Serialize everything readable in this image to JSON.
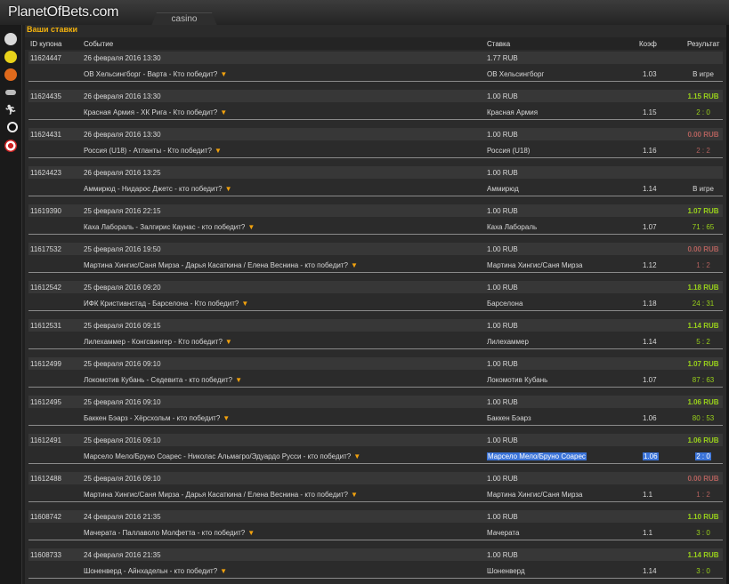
{
  "logo": "PlanetOfBets.com",
  "casino_tab": "casino",
  "panel_title": "Ваши ставки",
  "columns": {
    "id": "ID купона",
    "event": "Событие",
    "stake": "Ставка",
    "coef": "Коэф",
    "result": "Результат"
  },
  "sidebar_icons": [
    "soccer-ball-icon",
    "tennis-ball-icon",
    "basketball-icon",
    "hockey-icon",
    "athletics-icon",
    "billiards-icon",
    "darts-icon"
  ],
  "colors": {
    "accent": "#f2b20e",
    "win": "#99d11b",
    "lose": "#b0605c",
    "selection": "#3a73d8"
  },
  "bets": [
    {
      "id": "11624447",
      "date": "26 февраля 2016 13:30",
      "stake": "1.77 RUB",
      "event": "ОВ Хельсингборг - Варта - Кто победит?",
      "selection": "ОВ Хельсингборг",
      "coef": "1.03",
      "amount": "",
      "result": "В игре",
      "status": "ingame"
    },
    {
      "id": "11624435",
      "date": "26 февраля 2016 13:30",
      "stake": "1.00 RUB",
      "event": "Красная Армия - ХК Рига - Кто победит?",
      "selection": "Красная Армия",
      "coef": "1.15",
      "amount": "1.15 RUB",
      "result": "2 : 0",
      "status": "win"
    },
    {
      "id": "11624431",
      "date": "26 февраля 2016 13:30",
      "stake": "1.00 RUB",
      "event": "Россия (U18) - Атланты - Кто победит?",
      "selection": "Россия (U18)",
      "coef": "1.16",
      "amount": "0.00 RUB",
      "result": "2 : 2",
      "status": "lose"
    },
    {
      "id": "11624423",
      "date": "26 февраля 2016 13:25",
      "stake": "1.00 RUB",
      "event": "Аммирюд - Нидарос Джетс - кто победит?",
      "selection": "Аммирюд",
      "coef": "1.14",
      "amount": "",
      "result": "В игре",
      "status": "ingame"
    },
    {
      "id": "11619390",
      "date": "25 февраля 2016 22:15",
      "stake": "1.00 RUB",
      "event": "Каха Лабораль - Залгирис Каунас - кто победит?",
      "selection": "Каха Лабораль",
      "coef": "1.07",
      "amount": "1.07 RUB",
      "result": "71 : 65",
      "status": "win"
    },
    {
      "id": "11617532",
      "date": "25 февраля 2016 19:50",
      "stake": "1.00 RUB",
      "event": "Мартина Хингис/Саня Мирза - Дарья Касаткина / Елена Веснина - кто победит?",
      "selection": "Мартина Хингис/Саня Мирза",
      "coef": "1.12",
      "amount": "0.00 RUB",
      "result": "1 : 2",
      "status": "lose"
    },
    {
      "id": "11612542",
      "date": "25 февраля 2016 09:20",
      "stake": "1.00 RUB",
      "event": "ИФК Кристианстад - Барселона - Кто победит?",
      "selection": "Барселона",
      "coef": "1.18",
      "amount": "1.18 RUB",
      "result": "24 : 31",
      "status": "win"
    },
    {
      "id": "11612531",
      "date": "25 февраля 2016 09:15",
      "stake": "1.00 RUB",
      "event": "Лилехаммер - Конгсвингер - Кто победит?",
      "selection": "Лилехаммер",
      "coef": "1.14",
      "amount": "1.14 RUB",
      "result": "5 : 2",
      "status": "win"
    },
    {
      "id": "11612499",
      "date": "25 февраля 2016 09:10",
      "stake": "1.00 RUB",
      "event": "Локомотив Кубань - Седевита - кто победит?",
      "selection": "Локомотив Кубань",
      "coef": "1.07",
      "amount": "1.07 RUB",
      "result": "87 : 63",
      "status": "win"
    },
    {
      "id": "11612495",
      "date": "25 февраля 2016 09:10",
      "stake": "1.00 RUB",
      "event": "Баккен Бэарз - Хёрсхольм - кто победит?",
      "selection": "Баккен Бэарз",
      "coef": "1.06",
      "amount": "1.06 RUB",
      "result": "80 : 53",
      "status": "win"
    },
    {
      "id": "11612491",
      "date": "25 февраля 2016 09:10",
      "stake": "1.00 RUB",
      "event": "Марсело Мело/Бруно Соарес - Николас Альмагро/Эдуардо Русси - кто победит?",
      "selection": "Марсело Мело/Бруно Соарес",
      "coef": "1.06",
      "amount": "1.06 RUB",
      "result": "2 : 0",
      "status": "win",
      "highlighted": true
    },
    {
      "id": "11612488",
      "date": "25 февраля 2016 09:10",
      "stake": "1.00 RUB",
      "event": "Мартина Хингис/Саня Мирза - Дарья Касаткина / Елена Веснина - кто победит?",
      "selection": "Мартина Хингис/Саня Мирза",
      "coef": "1.1",
      "amount": "0.00 RUB",
      "result": "1 : 2",
      "status": "lose"
    },
    {
      "id": "11608742",
      "date": "24 февраля 2016 21:35",
      "stake": "1.00 RUB",
      "event": "Мачерата - Паллаволо Молфетта - кто победит?",
      "selection": "Мачерата",
      "coef": "1.1",
      "amount": "1.10 RUB",
      "result": "3 : 0",
      "status": "win"
    },
    {
      "id": "11608733",
      "date": "24 февраля 2016 21:35",
      "stake": "1.00 RUB",
      "event": "Шоненверд - Айнхадельн - кто победит?",
      "selection": "Шоненверд",
      "coef": "1.14",
      "amount": "1.14 RUB",
      "result": "3 : 0",
      "status": "win"
    }
  ]
}
